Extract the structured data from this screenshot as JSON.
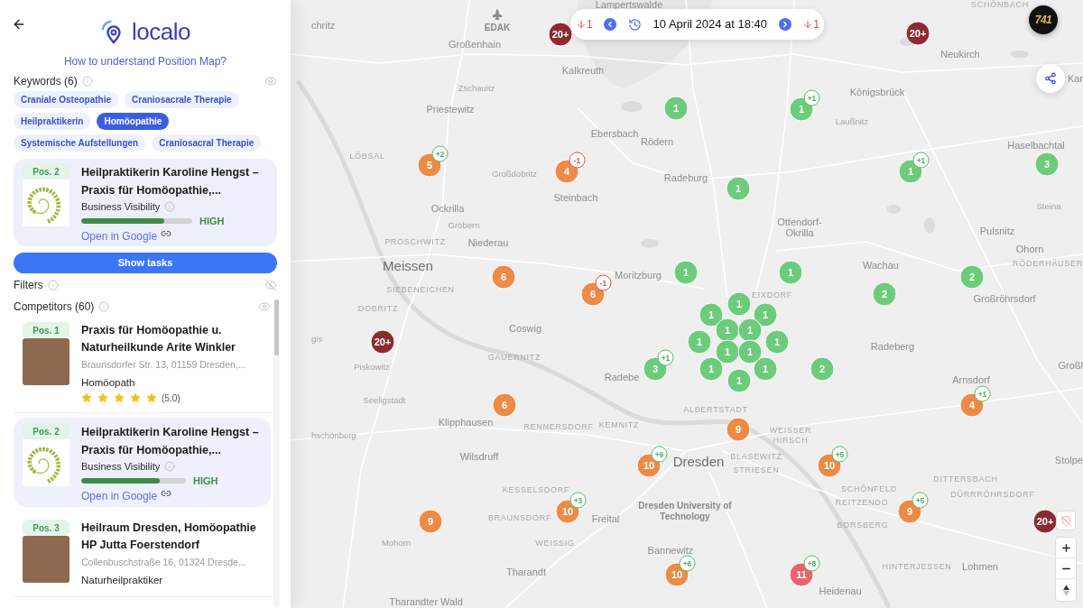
{
  "header": {
    "logo": "localo",
    "help_link": "How to understand Position Map?"
  },
  "keywords": {
    "title": "Keywords (6)",
    "shown": true,
    "items": [
      {
        "label": "Craniale Osteopathie",
        "selected": false
      },
      {
        "label": "Craniosacrale Therapie",
        "selected": false
      },
      {
        "label": "Heilpraktikerin",
        "selected": false
      },
      {
        "label": "Homöopathie",
        "selected": true
      },
      {
        "label": "Systemische Aufstellungen",
        "selected": false
      },
      {
        "label": "Craniosacral Therapie",
        "selected": false
      }
    ]
  },
  "business": {
    "position": "Pos. 2",
    "name": "Heilpraktikerin Karoline Hengst – Praxis für Homöopathie,...",
    "visibility_label": "Business Visibility",
    "level": 0.75,
    "visibility_rating": "HIGH",
    "link": "Open in Google"
  },
  "show_tasks": "Show tasks",
  "filters": {
    "title": "Filters",
    "shown": false
  },
  "competitors": {
    "title": "Competitors (60)",
    "shown": true,
    "items": [
      {
        "kind": "listing",
        "position": "Pos. 1",
        "name": "Praxis für Homöopathie u. Naturheilkunde Arite Winkler",
        "address": "Braunsdorfer Str. 13, 01159 Dresden,...",
        "category": "Homöopath",
        "stars": 5,
        "rating": "(5.0)"
      },
      {
        "kind": "own",
        "position": "Pos. 2",
        "name": "Heilpraktikerin Karoline Hengst – Praxis für Homöopathie,...",
        "visibility_label": "Business Visibility",
        "level": 0.75,
        "visibility_rating": "HIGH",
        "link": "Open in Google"
      },
      {
        "kind": "listing",
        "position": "Pos. 3",
        "name": "Heilraum Dresden, Homöopathie HP Jutta Foerstendorf",
        "address": "Collenbuschstraße 16, 01324 Dresde...",
        "category": "Naturheilpraktiker"
      }
    ]
  },
  "map": {
    "time_bar": {
      "previous_change": "1",
      "date": "10 April 2024 at 18:40",
      "next_change": "1"
    },
    "account_badge": "741",
    "labels": [
      {
        "text": "Lampertswalde",
        "kind": "town"
      },
      {
        "text": "SCHÖNBACH",
        "kind": "district"
      },
      {
        "text": "chritz",
        "kind": "town"
      },
      {
        "text": "EDAK",
        "kind": "landmark"
      },
      {
        "text": "Großenhain",
        "kind": "town"
      },
      {
        "text": "Neukirch",
        "kind": "town"
      },
      {
        "text": "Kalkreuth",
        "kind": "town"
      },
      {
        "text": "Kar",
        "kind": "town"
      },
      {
        "text": "Zschauitz",
        "kind": "village"
      },
      {
        "text": "Königsbrück",
        "kind": "town"
      },
      {
        "text": "Priestewitz",
        "kind": "town"
      },
      {
        "text": "Laußnitz",
        "kind": "village"
      },
      {
        "text": "Ebersbach",
        "kind": "town"
      },
      {
        "text": "Rödern",
        "kind": "town"
      },
      {
        "text": "Haselbachtal",
        "kind": "town"
      },
      {
        "text": "LÖBSAL",
        "kind": "district"
      },
      {
        "text": "Großdobritz",
        "kind": "village"
      },
      {
        "text": "Radeburg",
        "kind": "town"
      },
      {
        "text": "Steinbach",
        "kind": "town"
      },
      {
        "text": "Ockrilla",
        "kind": "town"
      },
      {
        "text": "Steina",
        "kind": "village"
      },
      {
        "text": "Gröbern",
        "kind": "village"
      },
      {
        "text": "Ottendorf-Okrilla",
        "kind": "town"
      },
      {
        "text": "Pulsnitz",
        "kind": "town"
      },
      {
        "text": "PROSCHWITZ",
        "kind": "district"
      },
      {
        "text": "Niederau",
        "kind": "town"
      },
      {
        "text": "Ohorn",
        "kind": "town"
      },
      {
        "text": "Meissen",
        "kind": "city"
      },
      {
        "text": "Wachau",
        "kind": "town"
      },
      {
        "text": "RÖDERHÄUSER",
        "kind": "district"
      },
      {
        "text": "Moritzburg",
        "kind": "town"
      },
      {
        "text": "SIEBENEICHEN",
        "kind": "district"
      },
      {
        "text": "EIXDORF",
        "kind": "district"
      },
      {
        "text": "Großröhrsdorf",
        "kind": "town"
      },
      {
        "text": "DOBRITZ",
        "kind": "district"
      },
      {
        "text": "Coswig",
        "kind": "town"
      },
      {
        "text": "gis",
        "kind": "village"
      },
      {
        "text": "Radeberg",
        "kind": "town"
      },
      {
        "text": "GAUERNITZ",
        "kind": "district"
      },
      {
        "text": "Piskowitz",
        "kind": "village"
      },
      {
        "text": "Großl",
        "kind": "town"
      },
      {
        "text": "Radebe",
        "kind": "town"
      },
      {
        "text": "Arnsdorf",
        "kind": "town"
      },
      {
        "text": "Seeligstadt",
        "kind": "village"
      },
      {
        "text": "ALBERTSTADT",
        "kind": "district"
      },
      {
        "text": "Klipphausen",
        "kind": "town"
      },
      {
        "text": "RENNERSDORF",
        "kind": "district"
      },
      {
        "text": "KEMNITZ",
        "kind": "district"
      },
      {
        "text": "hschönberg",
        "kind": "village"
      },
      {
        "text": "WEISSER HIRSCH",
        "kind": "district"
      },
      {
        "text": "Wilsdruff",
        "kind": "town"
      },
      {
        "text": "Dresden",
        "kind": "city"
      },
      {
        "text": "BLASEWITZ",
        "kind": "district"
      },
      {
        "text": "Stolpe",
        "kind": "town"
      },
      {
        "text": "STRIESEN",
        "kind": "district"
      },
      {
        "text": "DITTERSBACH",
        "kind": "district"
      },
      {
        "text": "KESSELSDORF",
        "kind": "district"
      },
      {
        "text": "SCHÖNFELD",
        "kind": "district"
      },
      {
        "text": "DÜRRRÖHRSDORF",
        "kind": "district"
      },
      {
        "text": "Dresden University of Technology",
        "kind": "landmark"
      },
      {
        "text": "REITZENDO",
        "kind": "district"
      },
      {
        "text": "BRAUNSDORF",
        "kind": "district"
      },
      {
        "text": "Freital",
        "kind": "town"
      },
      {
        "text": "BORSBERG",
        "kind": "district"
      },
      {
        "text": "Mohorn",
        "kind": "village"
      },
      {
        "text": "WEISSIG",
        "kind": "district"
      },
      {
        "text": "Bannewitz",
        "kind": "town"
      },
      {
        "text": "Tharandt",
        "kind": "town"
      },
      {
        "text": "HINTERJESSEN",
        "kind": "district"
      },
      {
        "text": "Lohmen",
        "kind": "town"
      },
      {
        "text": "Heidenau",
        "kind": "town"
      },
      {
        "text": "Tharandter Wald",
        "kind": "town"
      }
    ],
    "pins": [
      {
        "count": "20+",
        "color": "#8b2b30"
      },
      {
        "count": "20+",
        "color": "#8b2b30"
      },
      {
        "count": "1",
        "color": "#6dcb7c"
      },
      {
        "count": "1",
        "color": "#6dcb7c",
        "change": {
          "text": "+1",
          "kind": "gain"
        }
      },
      {
        "count": "5",
        "color": "#ec8b46",
        "change": {
          "text": "+2",
          "kind": "gain"
        }
      },
      {
        "count": "4",
        "color": "#ec8b46",
        "change": {
          "text": "-1",
          "kind": "loss"
        }
      },
      {
        "count": "1",
        "color": "#6dcb7c",
        "change": {
          "text": "+1",
          "kind": "gain"
        }
      },
      {
        "count": "3",
        "color": "#6dcb7c"
      },
      {
        "count": "1",
        "color": "#6dcb7c"
      },
      {
        "count": "6",
        "color": "#ec8b46"
      },
      {
        "count": "1",
        "color": "#6dcb7c"
      },
      {
        "count": "1",
        "color": "#6dcb7c"
      },
      {
        "count": "2",
        "color": "#6dcb7c"
      },
      {
        "count": "6",
        "color": "#ec8b46",
        "change": {
          "text": "-1",
          "kind": "loss"
        }
      },
      {
        "count": "2",
        "color": "#6dcb7c"
      },
      {
        "count": "1",
        "color": "#6dcb7c"
      },
      {
        "count": "1",
        "color": "#6dcb7c"
      },
      {
        "count": "1",
        "color": "#6dcb7c"
      },
      {
        "count": "1",
        "color": "#6dcb7c"
      },
      {
        "count": "1",
        "color": "#6dcb7c"
      },
      {
        "count": "20+",
        "color": "#8b2b30"
      },
      {
        "count": "1",
        "color": "#6dcb7c"
      },
      {
        "count": "1",
        "color": "#6dcb7c"
      },
      {
        "count": "1",
        "color": "#6dcb7c"
      },
      {
        "count": "1",
        "color": "#6dcb7c"
      },
      {
        "count": "3",
        "color": "#6dcb7c",
        "change": {
          "text": "+1",
          "kind": "gain"
        }
      },
      {
        "count": "1",
        "color": "#6dcb7c"
      },
      {
        "count": "1",
        "color": "#6dcb7c"
      },
      {
        "count": "2",
        "color": "#6dcb7c"
      },
      {
        "count": "1",
        "color": "#6dcb7c"
      },
      {
        "count": "6",
        "color": "#ec8b46"
      },
      {
        "count": "4",
        "color": "#ec8b46",
        "change": {
          "text": "+1",
          "kind": "gain"
        }
      },
      {
        "count": "9",
        "color": "#ec8b46"
      },
      {
        "count": "10",
        "color": "#ec8b46",
        "change": {
          "text": "+9",
          "kind": "gain"
        }
      },
      {
        "count": "10",
        "color": "#ec8b46",
        "change": {
          "text": "+5",
          "kind": "gain"
        }
      },
      {
        "count": "10",
        "color": "#ec8b46",
        "change": {
          "text": "+3",
          "kind": "gain"
        }
      },
      {
        "count": "9",
        "color": "#ec8b46",
        "change": {
          "text": "+5",
          "kind": "gain"
        }
      },
      {
        "count": "9",
        "color": "#ec8b46"
      },
      {
        "count": "20+",
        "color": "#8b2b30"
      },
      {
        "count": "10",
        "color": "#ec8b46",
        "change": {
          "text": "+6",
          "kind": "gain"
        }
      },
      {
        "count": "11",
        "color": "#e9636e",
        "change": {
          "text": "+8",
          "kind": "gain"
        }
      }
    ]
  }
}
